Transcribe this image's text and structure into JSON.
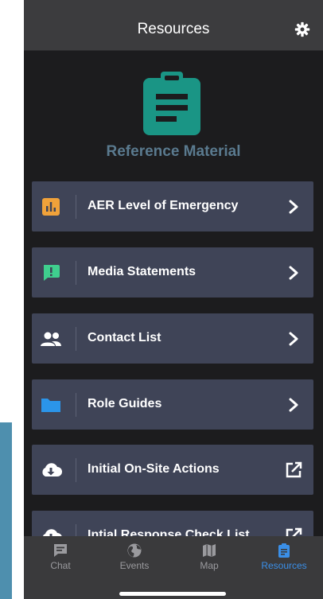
{
  "header": {
    "title": "Resources",
    "settings_icon": "gear-icon"
  },
  "hero": {
    "icon": "clipboard-icon",
    "icon_color": "#1a9585",
    "label": "Reference Material"
  },
  "menu": {
    "items": [
      {
        "label": "AER Level of Emergency",
        "icon": "bar-chart-icon",
        "icon_color": "#f0a23a",
        "action": "chevron"
      },
      {
        "label": "Media Statements",
        "icon": "alert-message-icon",
        "icon_color": "#3fcf8e",
        "action": "chevron"
      },
      {
        "label": "Contact List",
        "icon": "people-icon",
        "icon_color": "#ffffff",
        "action": "chevron"
      },
      {
        "label": "Role Guides",
        "icon": "folder-icon",
        "icon_color": "#2b95e9",
        "action": "chevron"
      },
      {
        "label": "Initial On-Site Actions",
        "icon": "cloud-download-icon",
        "icon_color": "#ffffff",
        "action": "external-link"
      },
      {
        "label": "Intial Response Check List",
        "icon": "cloud-download-icon",
        "icon_color": "#ffffff",
        "action": "external-link"
      }
    ]
  },
  "tabs": [
    {
      "label": "Chat",
      "icon": "chat-icon",
      "active": false
    },
    {
      "label": "Events",
      "icon": "globe-icon",
      "active": false
    },
    {
      "label": "Map",
      "icon": "map-icon",
      "active": false
    },
    {
      "label": "Resources",
      "icon": "clipboard-icon",
      "active": true
    }
  ],
  "colors": {
    "background": "#1c1c1e",
    "card": "#3f4457",
    "header": "#3c3c3e",
    "tab_active": "#3a8fe8",
    "tab_inactive": "#9a9a9e"
  }
}
